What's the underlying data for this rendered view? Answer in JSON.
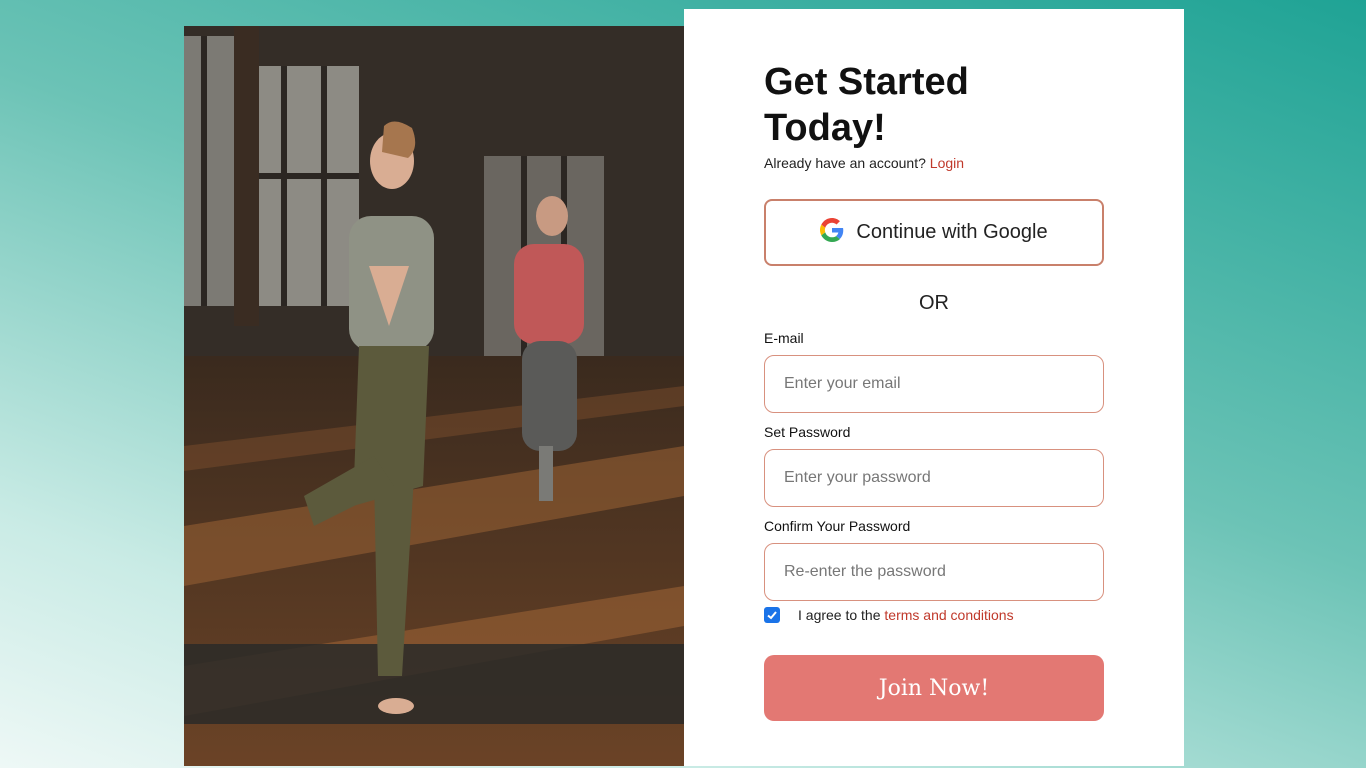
{
  "hero_image": {
    "alt": "Two women practicing tree pose yoga in a sunlit studio"
  },
  "form": {
    "title": "Get Started Today!",
    "login_prompt": "Already have an account?",
    "login_link": "Login",
    "google_button": "Continue with Google",
    "divider": "OR",
    "email": {
      "label": "E-mail",
      "placeholder": "Enter your email",
      "value": ""
    },
    "password": {
      "label": "Set Password",
      "placeholder": "Enter your password",
      "value": ""
    },
    "confirm_password": {
      "label": "Confirm Your Password",
      "placeholder": "Re-enter the password",
      "value": ""
    },
    "terms": {
      "checked": true,
      "text": "I agree to the",
      "link": "terms and conditions"
    },
    "submit": "Join Now!"
  },
  "colors": {
    "accent": "#c0392b",
    "button": "#e37873",
    "border": "#d8917f",
    "checkbox": "#1a73e8"
  }
}
